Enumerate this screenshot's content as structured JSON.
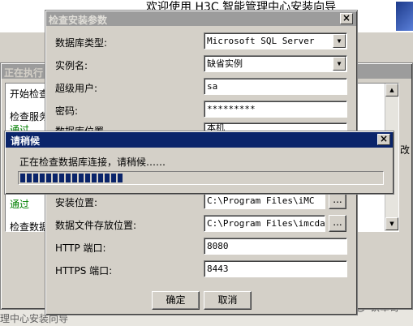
{
  "background_window": {
    "title": "欢迎使用 H3C 智能管理中心安装向导",
    "footer_text": "理中心安装向导"
  },
  "progress_window": {
    "title": "正在执行",
    "lines": [
      "开始检查",
      "检查服务",
      "通过",
      "通过",
      "检查数据"
    ]
  },
  "check_dialog": {
    "title": "检查安装参数",
    "close": "×",
    "db_type_label": "数据库类型:",
    "db_type_value": "Microsoft SQL Server",
    "instance_label": "实例名:",
    "instance_value": "缺省实例",
    "superuser_label": "超级用户:",
    "superuser_value": "sa",
    "password_label": "密码:",
    "password_value": "*********",
    "db_location_label": "数据库位置",
    "db_location_value": "本机",
    "install_location_label": "安装位置:",
    "install_location_value": "C:\\Program Files\\iMC",
    "datafile_label": "数据文件存放位置:",
    "datafile_value": "C:\\Program Files\\imcdata",
    "browse": "...",
    "http_label": "HTTP 端口:",
    "http_value": "8080",
    "https_label": "HTTPS 端口:",
    "https_value": "8443",
    "ok": "确定",
    "cancel": "取消"
  },
  "wait_dialog": {
    "title": "请稍候",
    "close": "×",
    "message": "正在检查数据库连接，请稍候……",
    "progress_fraction": 0.28
  },
  "watermark": {
    "text": "铁军哥"
  },
  "colors": {
    "active_title": "#0a246a",
    "progress_block": "#0a246a",
    "pass_text": "#008000",
    "face": "#d4d0c8"
  }
}
